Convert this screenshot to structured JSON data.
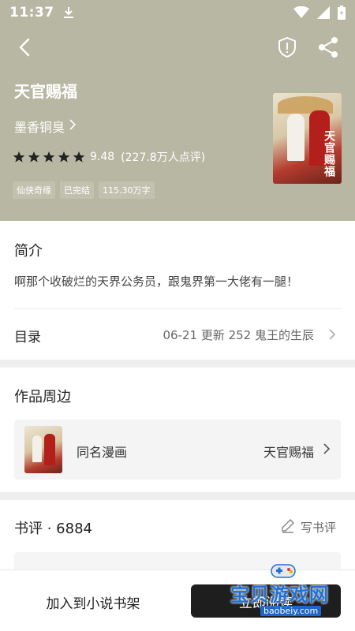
{
  "status_bar": {
    "time": "11:37"
  },
  "book": {
    "title": "天官赐福",
    "author": "墨香铜臭",
    "score": "9.48",
    "rating_count": "(227.8万人点评)",
    "stars": 5,
    "tags": [
      "仙侠奇缘",
      "已完结",
      "115.30万字"
    ],
    "cover_text": "天官赐福"
  },
  "intro": {
    "title": "简介",
    "body": "啊那个收破烂的天界公务员，跟鬼界第一大佬有一腿！"
  },
  "toc": {
    "label": "目录",
    "latest": "06-21  更新  252 鬼王的生辰"
  },
  "peripheral": {
    "title": "作品周边",
    "item_type": "同名漫画",
    "item_name": "天官赐福"
  },
  "reviews": {
    "title": "书评 · 6884",
    "write_label": "写书评"
  },
  "bottom": {
    "add_shelf": "加入到小说书架",
    "read": "立即阅读"
  },
  "watermark": {
    "name": "宝贝游戏网",
    "url": "baobeiy.com"
  },
  "colors": {
    "hero_bg": "#b8b7a3",
    "read_button": "#1e1e1e"
  }
}
